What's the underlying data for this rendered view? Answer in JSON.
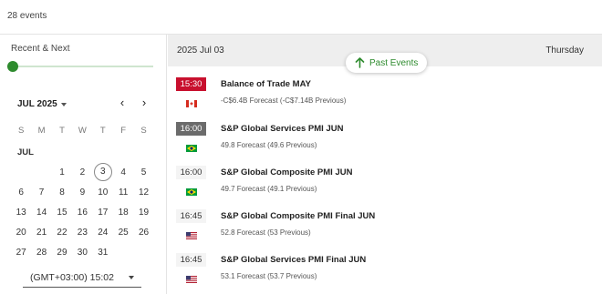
{
  "header": {
    "events_count": "28 events"
  },
  "filter": {
    "label": "Recent & Next",
    "level_percent": 0
  },
  "calendar": {
    "month_select": "JUL 2025",
    "month_label": "JUL",
    "weekdays": [
      "S",
      "M",
      "T",
      "W",
      "T",
      "F",
      "S"
    ],
    "weeks": [
      [
        "",
        "",
        "1",
        "2",
        "3",
        "4",
        "5"
      ],
      [
        "6",
        "7",
        "8",
        "9",
        "10",
        "11",
        "12"
      ],
      [
        "13",
        "14",
        "15",
        "16",
        "17",
        "18",
        "19"
      ],
      [
        "20",
        "21",
        "22",
        "23",
        "24",
        "25",
        "26"
      ],
      [
        "27",
        "28",
        "29",
        "30",
        "31",
        "",
        ""
      ]
    ],
    "today": "3"
  },
  "timezone": {
    "value": "(GMT+03:00) 15:02"
  },
  "day_header": {
    "date": "2025 Jul 03",
    "weekday": "Thursday"
  },
  "past_button": {
    "label": "Past Events"
  },
  "events": [
    {
      "time": "15:30",
      "style": "red",
      "flag": "canada-flag",
      "title": "Balance of Trade MAY",
      "detail": "-C$6.4B Forecast (-C$7.14B Previous)"
    },
    {
      "time": "16:00",
      "style": "gray",
      "flag": "brazil-flag",
      "title": "S&P Global Services PMI JUN",
      "detail": "49.8 Forecast (49.6 Previous)"
    },
    {
      "time": "16:00",
      "style": "plain",
      "flag": "brazil-flag",
      "title": "S&P Global Composite PMI JUN",
      "detail": "49.7 Forecast (49.1 Previous)"
    },
    {
      "time": "16:45",
      "style": "plain",
      "flag": "us-flag",
      "title": "S&P Global Composite PMI Final JUN",
      "detail": "52.8 Forecast (53 Previous)"
    },
    {
      "time": "16:45",
      "style": "plain",
      "flag": "us-flag",
      "title": "S&P Global Services PMI Final JUN",
      "detail": "53.1 Forecast (53.7 Previous)"
    }
  ],
  "colors": {
    "accent": "#2e8b2e",
    "highlight_red": "#c8102e",
    "gray": "#6b6b6b"
  }
}
